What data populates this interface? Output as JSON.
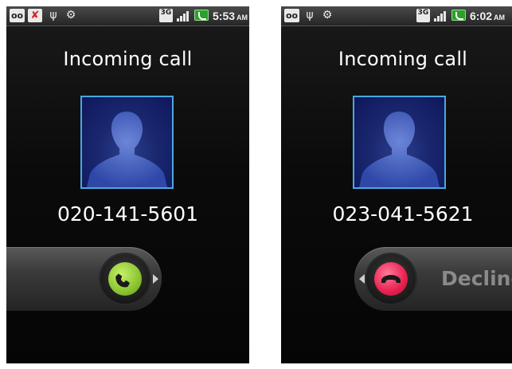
{
  "screens": [
    {
      "status_bar": {
        "time": "5:53",
        "ampm": "AM",
        "network": "3G"
      },
      "title": "Incoming call",
      "caller_number": "020-141-5601",
      "slider": {
        "action": "answer"
      }
    },
    {
      "status_bar": {
        "time": "6:02",
        "ampm": "AM",
        "network": "3G"
      },
      "title": "Incoming call",
      "caller_number": "023-041-5621",
      "slider": {
        "action": "decline",
        "label": "Decline"
      }
    }
  ],
  "colors": {
    "answer_accent": "#8cc430",
    "decline_accent": "#e8204f",
    "photo_border": "#4aa8e0"
  }
}
